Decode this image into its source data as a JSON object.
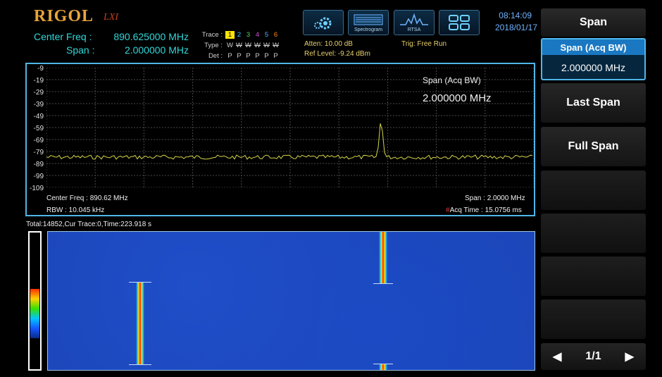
{
  "header": {
    "logo": "RIGOL",
    "logo_sub": "LXI",
    "center_freq_label": "Center Freq :",
    "center_freq_value": "890.625000 MHz",
    "span_label": "Span :",
    "span_value": "2.000000 MHz",
    "trace": {
      "labels": [
        "Trace :",
        "Type :",
        "Det :"
      ],
      "numbers": [
        "1",
        "2",
        "3",
        "4",
        "5",
        "6"
      ],
      "types": [
        "W",
        "W",
        "W",
        "W",
        "W",
        "W"
      ],
      "detectors": [
        "P",
        "P",
        "P",
        "P",
        "P",
        "P"
      ]
    },
    "atten": "Atten: 10.00 dB",
    "ref_level": "Ref Level: -9.24 dBm",
    "trig": "Trig: Free Run",
    "toolbar": [
      {
        "name": "settings",
        "label": ""
      },
      {
        "name": "spectrogram",
        "label": "Spectrogram"
      },
      {
        "name": "rtsa",
        "label": "RTSA"
      },
      {
        "name": "layout",
        "label": ""
      }
    ],
    "time": "08:14:09",
    "date": "2018/01/17"
  },
  "spectrum": {
    "y_ticks": [
      "-9",
      "-19",
      "-29",
      "-39",
      "-49",
      "-59",
      "-69",
      "-79",
      "-89",
      "-99",
      "-109"
    ],
    "overlay_title": "Span (Acq BW)",
    "overlay_value": "2.000000 MHz",
    "center_freq": "Center Freq : 890.62 MHz",
    "rbw": "RBW : 10.045 kHz",
    "span": "Span : 2.0000 MHz",
    "acq_time": "Acq Time : 15.0756 ms",
    "trace_color": "#d6d64a"
  },
  "spectrogram": {
    "header": "Total:14852,Cur Trace:0,Time:223.918 s"
  },
  "softkeys": {
    "title": "Span",
    "active_header": "Span (Acq BW)",
    "active_value": "2.000000 MHz",
    "last_span": "Last Span",
    "full_span": "Full Span",
    "page": "1/1"
  },
  "colors": {
    "accent": "#4fb6e8",
    "header_text": "#32d7d9",
    "spectrogram_bg": "#1c46b8"
  }
}
